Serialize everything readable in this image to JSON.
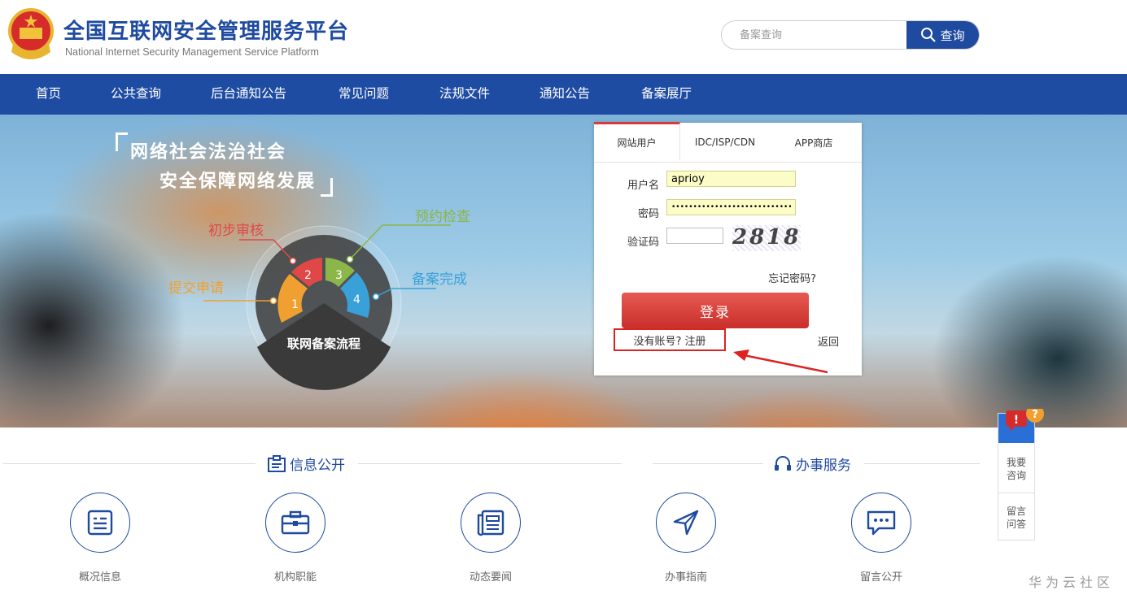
{
  "header": {
    "title": "全国互联网安全管理服务平台",
    "subtitle": "National Internet Security Management Service Platform",
    "search": {
      "placeholder": "备案查询",
      "button_label": "查询"
    }
  },
  "nav": {
    "items": [
      "首页",
      "公共查询",
      "后台通知公告",
      "常见问题",
      "法规文件",
      "通知公告",
      "备案展厅"
    ]
  },
  "banner": {
    "slogan_line1": "网络社会法治社会",
    "slogan_line2": "安全保障网络发展",
    "process": {
      "center_label": "联网备案流程",
      "steps": [
        {
          "num": "1",
          "label": "提交申请",
          "color": "#f0a030"
        },
        {
          "num": "2",
          "label": "初步审核",
          "color": "#e04848"
        },
        {
          "num": "3",
          "label": "预约检查",
          "color": "#8cb54a"
        },
        {
          "num": "4",
          "label": "备案完成",
          "color": "#3aa0d8"
        }
      ]
    }
  },
  "login": {
    "tabs": [
      "网站用户",
      "IDC/ISP/CDN",
      "APP商店"
    ],
    "active_tab": 0,
    "username_label": "用户名",
    "username_value": "aprioy",
    "password_label": "密码",
    "password_value": "••••••••••••••••••••••••••••••••",
    "captcha_label": "验证码",
    "captcha_value": "",
    "captcha_text": "2818",
    "forgot": "忘记密码?",
    "login_button": "登录",
    "register": "没有账号? 注册",
    "back": "返回"
  },
  "sections": {
    "info": {
      "title": "信息公开",
      "items": [
        {
          "label": "概况信息",
          "icon": "document-list-icon"
        },
        {
          "label": "机构职能",
          "icon": "briefcase-icon"
        },
        {
          "label": "动态要闻",
          "icon": "newspaper-icon"
        }
      ]
    },
    "service": {
      "title": "办事服务",
      "items": [
        {
          "label": "办事指南",
          "icon": "navigation-arrow-icon"
        },
        {
          "label": "留言公开",
          "icon": "chat-bubble-icon"
        }
      ]
    }
  },
  "float_panel": {
    "consult": "我要咨询",
    "message": "留言问答"
  },
  "watermark": "华为云社区",
  "colors": {
    "brand_blue": "#1e4aa0",
    "login_red": "#d93a3a",
    "annotation_red": "#dd2222"
  }
}
